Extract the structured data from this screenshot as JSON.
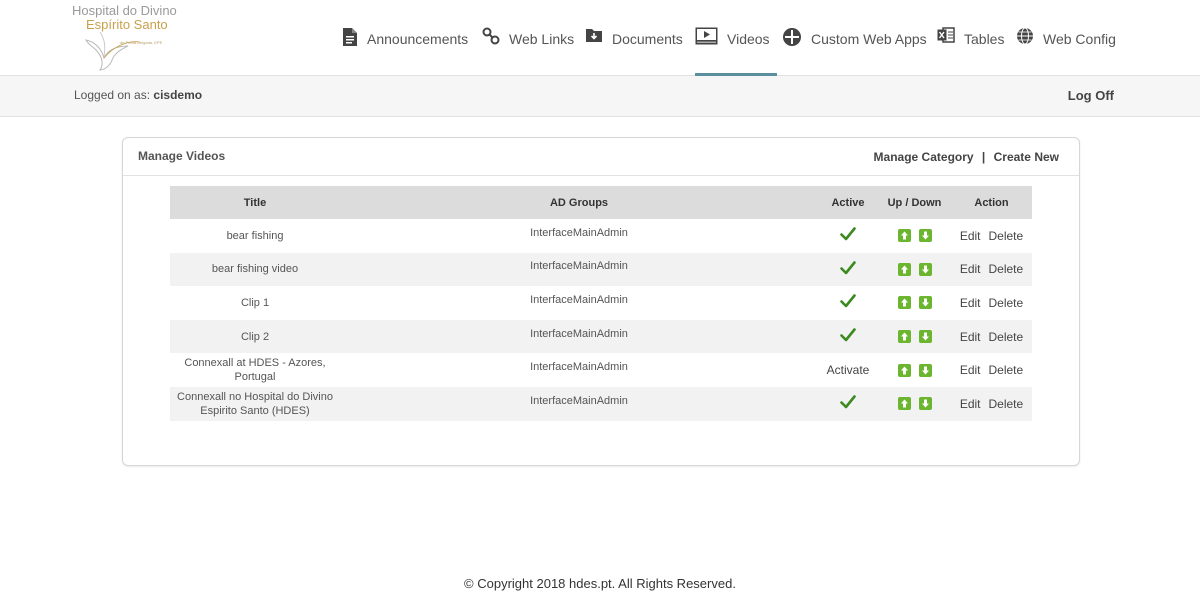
{
  "logo": {
    "line1": "Hospital do Divino",
    "line2": "Espírito Santo",
    "line3": "de Ponta Delgada, EPE"
  },
  "nav": [
    {
      "label": "Announcements",
      "icon": "document-icon"
    },
    {
      "label": "Web Links",
      "icon": "link-icon"
    },
    {
      "label": "Documents",
      "icon": "folder-download-icon"
    },
    {
      "label": "Videos",
      "icon": "video-player-icon",
      "active": true
    },
    {
      "label": "Custom Web Apps",
      "icon": "grid-circle-icon"
    },
    {
      "label": "Tables",
      "icon": "excel-icon"
    },
    {
      "label": "Web Config",
      "icon": "globe-icon"
    }
  ],
  "session": {
    "logged_prefix": "Logged on as:",
    "username": "cisdemo",
    "logoff": "Log Off"
  },
  "panel": {
    "title": "Manage Videos",
    "manage_category": "Manage Category",
    "separator": "|",
    "create_new": "Create New"
  },
  "table": {
    "headers": {
      "title": "Title",
      "groups": "AD Groups",
      "active": "Active",
      "updown": "Up / Down",
      "action": "Action"
    },
    "edit_label": "Edit",
    "delete_label": "Delete",
    "activate_label": "Activate",
    "rows": [
      {
        "title": "bear fishing",
        "groups": "InterfaceMainAdmin",
        "active": true
      },
      {
        "title": "bear fishing video",
        "groups": "InterfaceMainAdmin",
        "active": true
      },
      {
        "title": "Clip 1",
        "groups": "InterfaceMainAdmin",
        "active": true
      },
      {
        "title": "Clip 2",
        "groups": "InterfaceMainAdmin",
        "active": true
      },
      {
        "title": "Connexall at HDES - Azores, Portugal",
        "groups": "InterfaceMainAdmin",
        "active": false
      },
      {
        "title": "Connexall no Hospital do Divino Espirito Santo (HDES)",
        "groups": "InterfaceMainAdmin",
        "active": true
      }
    ]
  },
  "footer": "© Copyright 2018 hdes.pt. All Rights Reserved.",
  "colors": {
    "accent_underline": "#5b8fa0",
    "check_green": "#3a8a1f",
    "arrow_green": "#6cb52e",
    "logo_gold": "#c9a04a"
  }
}
